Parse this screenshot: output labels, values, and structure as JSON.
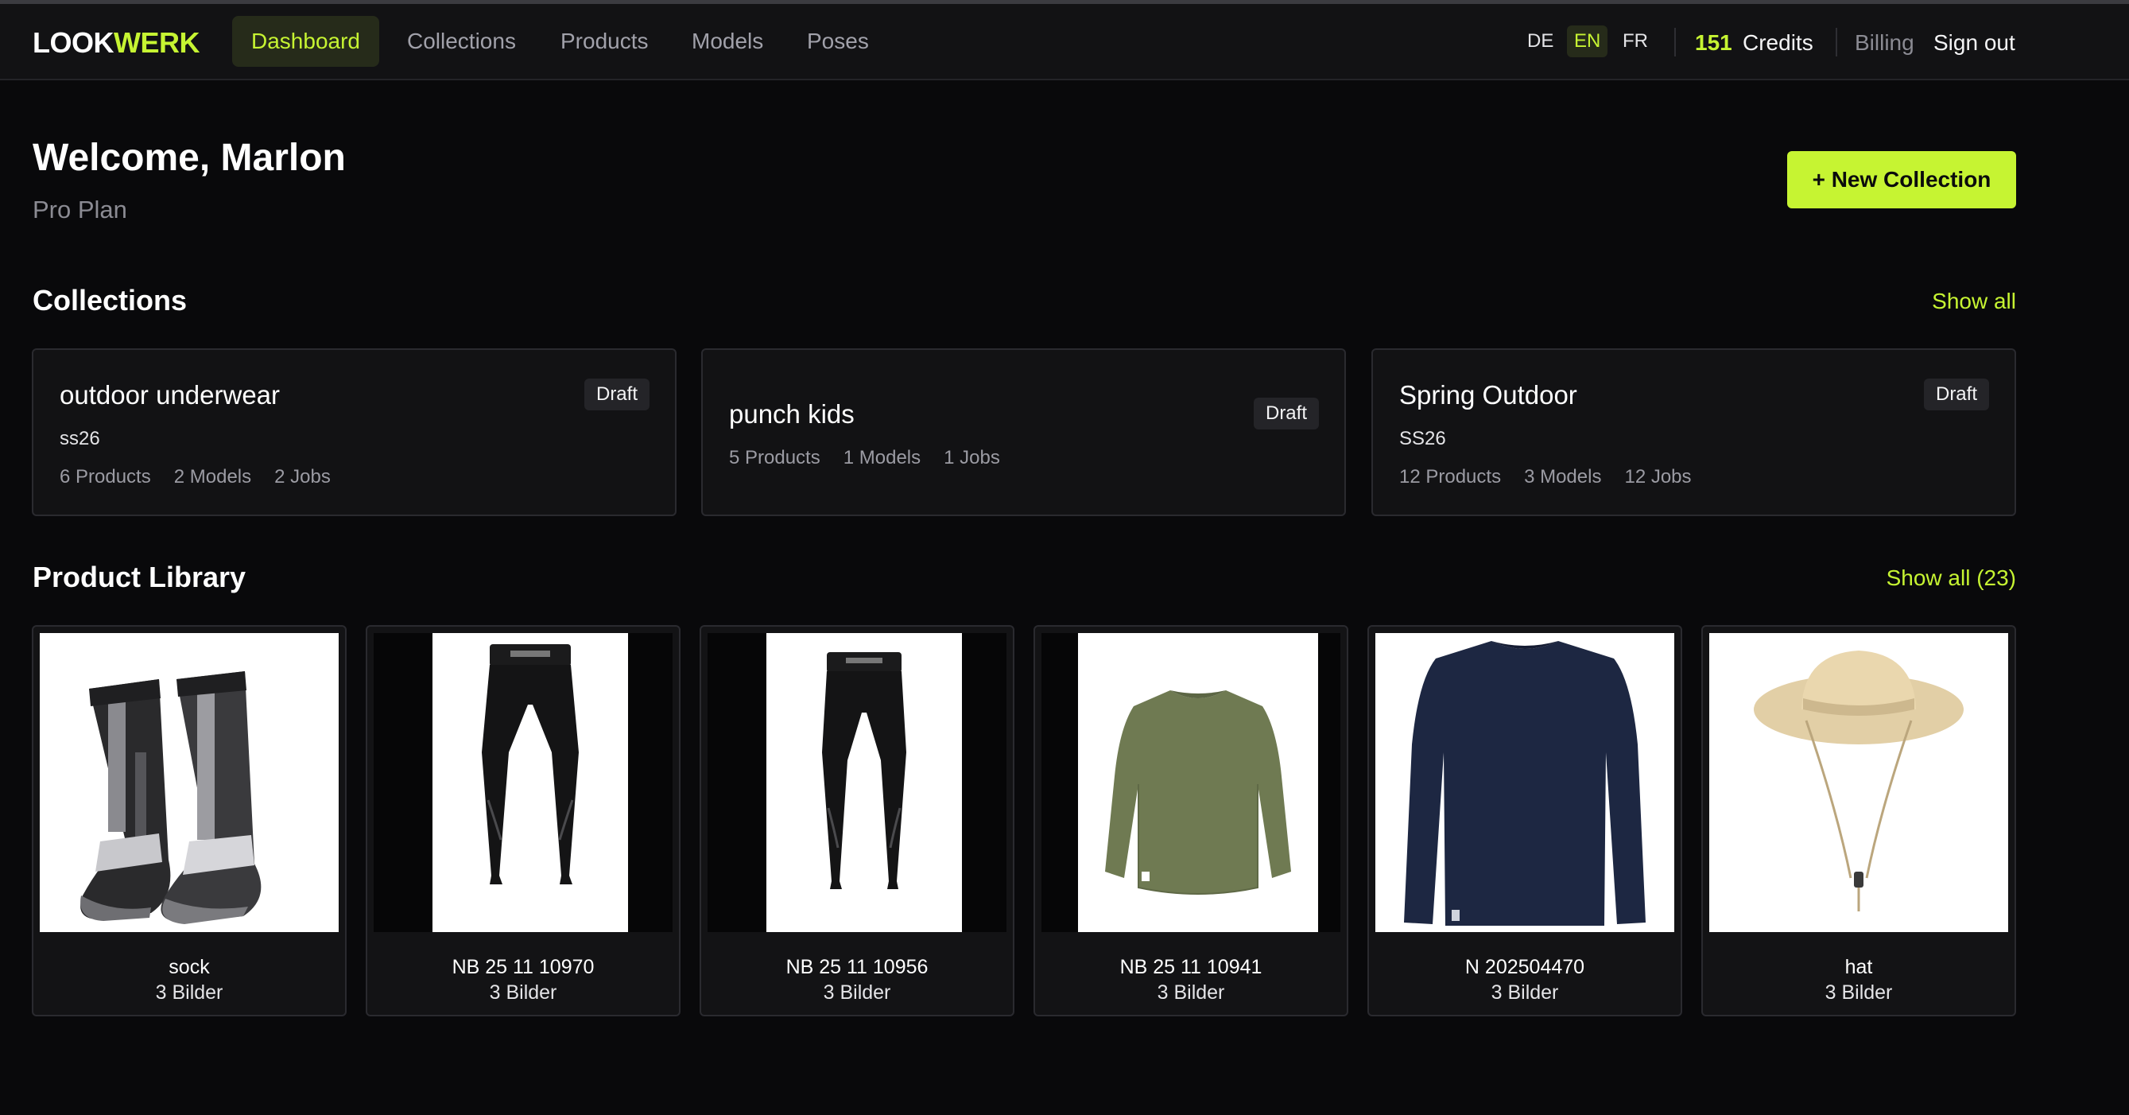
{
  "brand": {
    "part1": "LOOK",
    "part2": "WERK"
  },
  "nav": {
    "items": [
      {
        "label": "Dashboard",
        "active": true
      },
      {
        "label": "Collections",
        "active": false
      },
      {
        "label": "Products",
        "active": false
      },
      {
        "label": "Models",
        "active": false
      },
      {
        "label": "Poses",
        "active": false
      }
    ],
    "languages": [
      {
        "code": "DE",
        "active": false
      },
      {
        "code": "EN",
        "active": true
      },
      {
        "code": "FR",
        "active": false
      }
    ],
    "credits_value": "151",
    "credits_label": "Credits",
    "billing_label": "Billing",
    "signout_label": "Sign out"
  },
  "header": {
    "welcome": "Welcome, Marlon",
    "plan": "Pro Plan",
    "new_collection_label": "+ New Collection"
  },
  "collections": {
    "title": "Collections",
    "show_all_label": "Show all",
    "items": [
      {
        "name": "outdoor underwear",
        "season": "ss26",
        "status": "Draft",
        "products": "6 Products",
        "models": "2 Models",
        "jobs": "2 Jobs"
      },
      {
        "name": "punch kids",
        "season": "",
        "status": "Draft",
        "products": "5 Products",
        "models": "1 Models",
        "jobs": "1 Jobs"
      },
      {
        "name": "Spring Outdoor",
        "season": "SS26",
        "status": "Draft",
        "products": "12 Products",
        "models": "3 Models",
        "jobs": "12 Jobs"
      }
    ]
  },
  "products": {
    "title": "Product Library",
    "show_all_label": "Show all (23)",
    "items": [
      {
        "name": "sock",
        "images": "3 Bilder",
        "icon": "sock-image"
      },
      {
        "name": "NB 25 11 10970",
        "images": "3 Bilder",
        "icon": "leggings-image"
      },
      {
        "name": "NB 25 11 10956",
        "images": "3 Bilder",
        "icon": "leggings-image"
      },
      {
        "name": "NB 25 11 10941",
        "images": "3 Bilder",
        "icon": "olive-longsleeve-image"
      },
      {
        "name": "N 202504470",
        "images": "3 Bilder",
        "icon": "navy-longsleeve-image"
      },
      {
        "name": "hat",
        "images": "3 Bilder",
        "icon": "bucket-hat-image"
      }
    ]
  },
  "colors": {
    "accent": "#c6f432",
    "background": "#09090b",
    "surface": "#121214",
    "border": "#2a2a2f",
    "muted_text": "#8b8b93"
  }
}
